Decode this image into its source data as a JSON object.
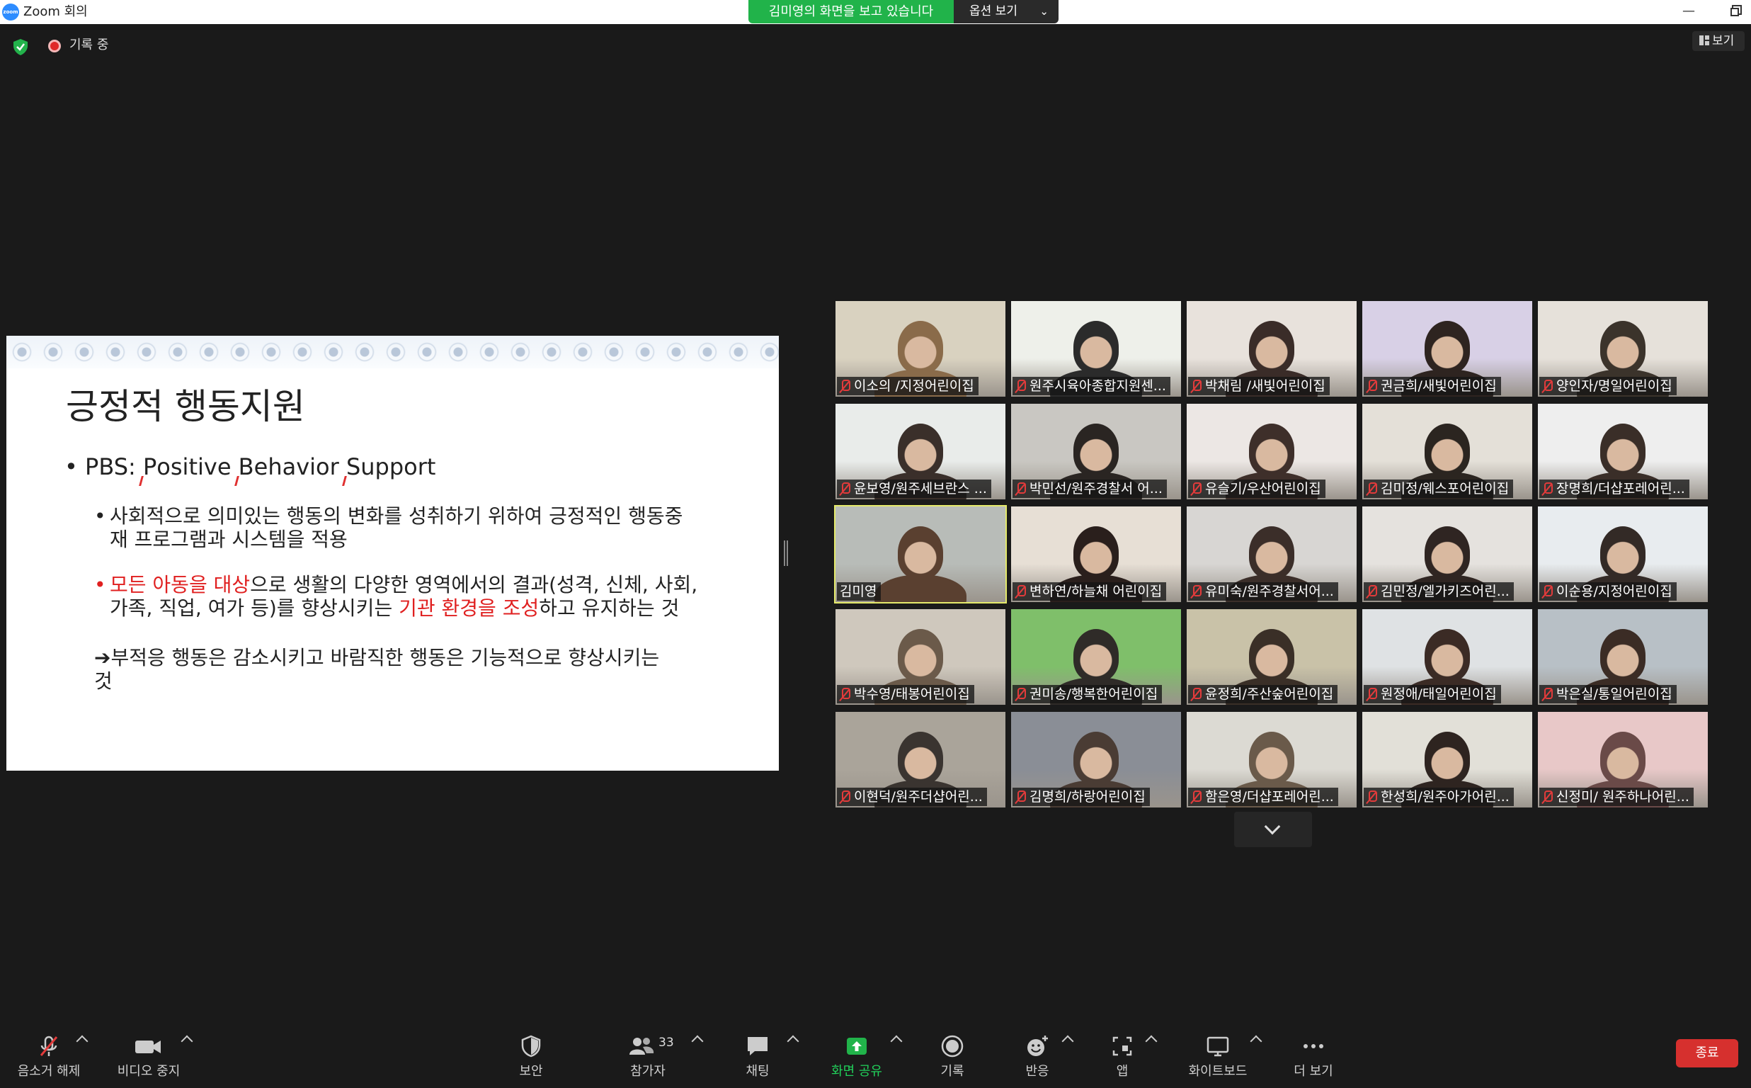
{
  "titlebar": {
    "app_icon": "zoom",
    "title": "Zoom 회의",
    "share_banner": "김미영의 화면을 보고 있습니다",
    "view_options": "옵션 보기",
    "minimize": "—"
  },
  "status": {
    "security_icon": "shield-check-icon",
    "recording": "기록 중",
    "view": "보기"
  },
  "slide": {
    "title": "긍정적 행동지원",
    "bullet1_prefix": "PBS: ",
    "bullet1_p": "P",
    "bullet1_ositive": "ositive ",
    "bullet1_b": "B",
    "bullet1_ehavior": "ehavior ",
    "bullet1_s": "S",
    "bullet1_upport": "upport",
    "bullet2_line1": "사회적으로 의미있는 행동의 변화를 성취하기 위하여 긍정적인 행동중",
    "bullet2_line2": "재 프로그램과 시스템을 적용",
    "bullet3_red1": "모든 아동을 대상",
    "bullet3_text1": "으로 생활의 다양한 영역에서의 결과(성격, 신체, 사회,",
    "bullet3_text2": "가족, 직업, 여가 등)를 향상시키는 ",
    "bullet3_red2": "기관 환경을 조성",
    "bullet3_text3": "하고 유지하는 것",
    "bullet4_arrow": "➔",
    "bullet4_line1": "부적응 행동은 감소시키고 바람직한 행동은 기능적으로 향상시키는",
    "bullet4_line2": "것"
  },
  "participants": [
    {
      "name": "이소의 /지정어린이집",
      "muted": true
    },
    {
      "name": "원주시육아종합지원센...",
      "muted": true
    },
    {
      "name": "박채림 /새빛어린이집",
      "muted": true
    },
    {
      "name": "권금희/새빛어린이집",
      "muted": true
    },
    {
      "name": "양인자/명일어린이집",
      "muted": true
    },
    {
      "name": "윤보영/원주세브란스 ...",
      "muted": true
    },
    {
      "name": "박민선/원주경찰서 어...",
      "muted": true
    },
    {
      "name": "유슬기/우산어린이집",
      "muted": true
    },
    {
      "name": "김미정/웨스포어린이집",
      "muted": true
    },
    {
      "name": "장명희/더샵포레어린...",
      "muted": true
    },
    {
      "name": "김미영",
      "muted": false,
      "active": true
    },
    {
      "name": "변하연/하늘채 어린이집",
      "muted": true
    },
    {
      "name": "유미숙/원주경찰서어...",
      "muted": true
    },
    {
      "name": "김민정/엘가키즈어린...",
      "muted": true
    },
    {
      "name": "이순용/지정어린이집",
      "muted": true
    },
    {
      "name": "박수영/태봉어린이집",
      "muted": true
    },
    {
      "name": "권미송/행복한어린이집",
      "muted": true
    },
    {
      "name": "윤정희/주산숲어린이집",
      "muted": true
    },
    {
      "name": "원정애/태일어린이집",
      "muted": true
    },
    {
      "name": "박은실/통일어린이집",
      "muted": true
    },
    {
      "name": "이현덕/원주더샵어린...",
      "muted": true
    },
    {
      "name": "김명희/하랑어린이집",
      "muted": true
    },
    {
      "name": "함은영/더샵포레어린...",
      "muted": true
    },
    {
      "name": "한성희/원주아가어린...",
      "muted": true
    },
    {
      "name": "신정미/ 원주하나어린...",
      "muted": true
    }
  ],
  "toolbar": {
    "unmute": "음소거 해제",
    "stop_video": "비디오 중지",
    "security": "보안",
    "participants": "참가자",
    "participants_count": "33",
    "chat": "채팅",
    "share_screen": "화면 공유",
    "record": "기록",
    "reactions": "반응",
    "apps": "앱",
    "whiteboard": "화이트보드",
    "more": "더 보기",
    "end": "종료"
  },
  "colors": {
    "accent_green": "#21b34a",
    "end_red": "#d6302e",
    "active_speaker": "#e5ea6b",
    "mute_red": "#e23b3b"
  }
}
